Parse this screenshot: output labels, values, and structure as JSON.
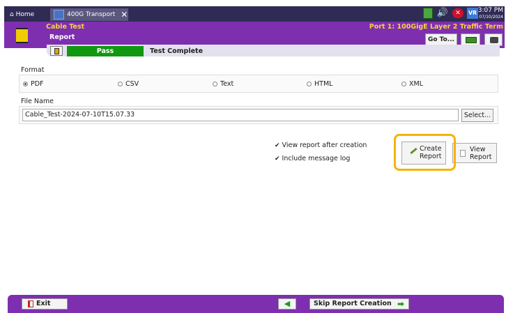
{
  "titlebar": {
    "home_tab": "⌂ Home",
    "transport_tab": "400G Transport",
    "close_glyph": "✕",
    "time": "3:07 PM",
    "date": "07/10/2024",
    "vr_label": "VR"
  },
  "header": {
    "app_name": "Cable Test",
    "page": "Report",
    "port_info": "Port 1: 100GigE Layer 2 Traffic Term",
    "goto_label": "Go To..."
  },
  "status": {
    "result": "Pass",
    "state": "Test Complete"
  },
  "format": {
    "label": "Format",
    "options": [
      "PDF",
      "CSV",
      "Text",
      "HTML",
      "XML"
    ],
    "selected": "PDF"
  },
  "file": {
    "label": "File Name",
    "value": "Cable_Test-2024-07-10T15.07.33",
    "select_label": "Select..."
  },
  "options": {
    "view_after": "View report after creation",
    "include_log": "Include message log"
  },
  "actions": {
    "create_line1": "Create",
    "create_line2": "Report",
    "view_line1": "View",
    "view_line2": "Report"
  },
  "bottom": {
    "exit_label": "Exit",
    "back_glyph": "◀",
    "skip_label": "Skip Report Creation",
    "skip_glyph": "➡"
  },
  "colors": {
    "accent_purple": "#7d2fb0",
    "pass_green": "#119811",
    "highlight": "#f4b400"
  }
}
